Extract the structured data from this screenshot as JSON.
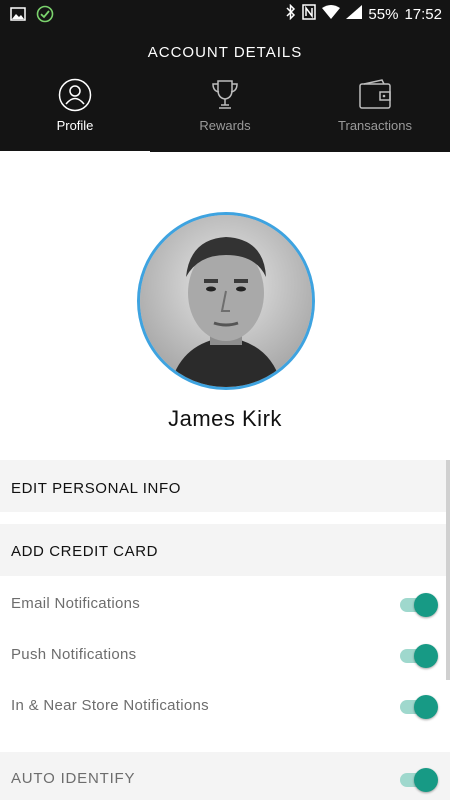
{
  "status": {
    "battery": "55%",
    "time": "17:52"
  },
  "header": {
    "title": "ACCOUNT DETAILS"
  },
  "tabs": [
    {
      "label": "Profile",
      "icon": "profile-icon",
      "active": true
    },
    {
      "label": "Rewards",
      "icon": "trophy-icon",
      "active": false
    },
    {
      "label": "Transactions",
      "icon": "wallet-icon",
      "active": false
    }
  ],
  "profile": {
    "name": "James Kirk"
  },
  "actions": {
    "edit_info": "EDIT PERSONAL INFO",
    "add_card": "ADD CREDIT CARD"
  },
  "settings": [
    {
      "label": "Email Notifications",
      "on": true
    },
    {
      "label": "Push Notifications",
      "on": true
    },
    {
      "label": "In & Near Store Notifications",
      "on": true
    }
  ],
  "auto_identify": {
    "label": "AUTO IDENTIFY",
    "on": true
  },
  "colors": {
    "header_bg": "#141414",
    "accent": "#179a85",
    "avatar_ring": "#3ea3e0"
  }
}
